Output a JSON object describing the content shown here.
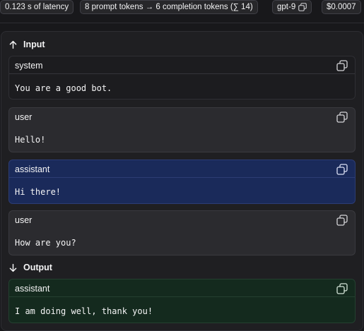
{
  "metrics": {
    "latency": "0.123 s of latency",
    "tokens": "8 prompt tokens → 6 completion tokens (∑ 14)",
    "model": "gpt-9",
    "cost": "$0.0007"
  },
  "input": {
    "header": "Input",
    "messages": [
      {
        "role": "system",
        "content": "You are a good bot."
      },
      {
        "role": "user",
        "content": "Hello!"
      },
      {
        "role": "assistant",
        "content": "Hi there!"
      },
      {
        "role": "user",
        "content": "How are you?"
      }
    ]
  },
  "output": {
    "header": "Output",
    "messages": [
      {
        "role": "assistant",
        "content": "I am doing well, thank you!"
      }
    ]
  },
  "icons": {
    "copy": "copy-icon",
    "arrow_up": "arrow-up-icon",
    "arrow_down": "arrow-down-icon"
  },
  "colors": {
    "assistant_input_bg": "#1a2a5a",
    "assistant_output_bg": "#142a1e"
  }
}
